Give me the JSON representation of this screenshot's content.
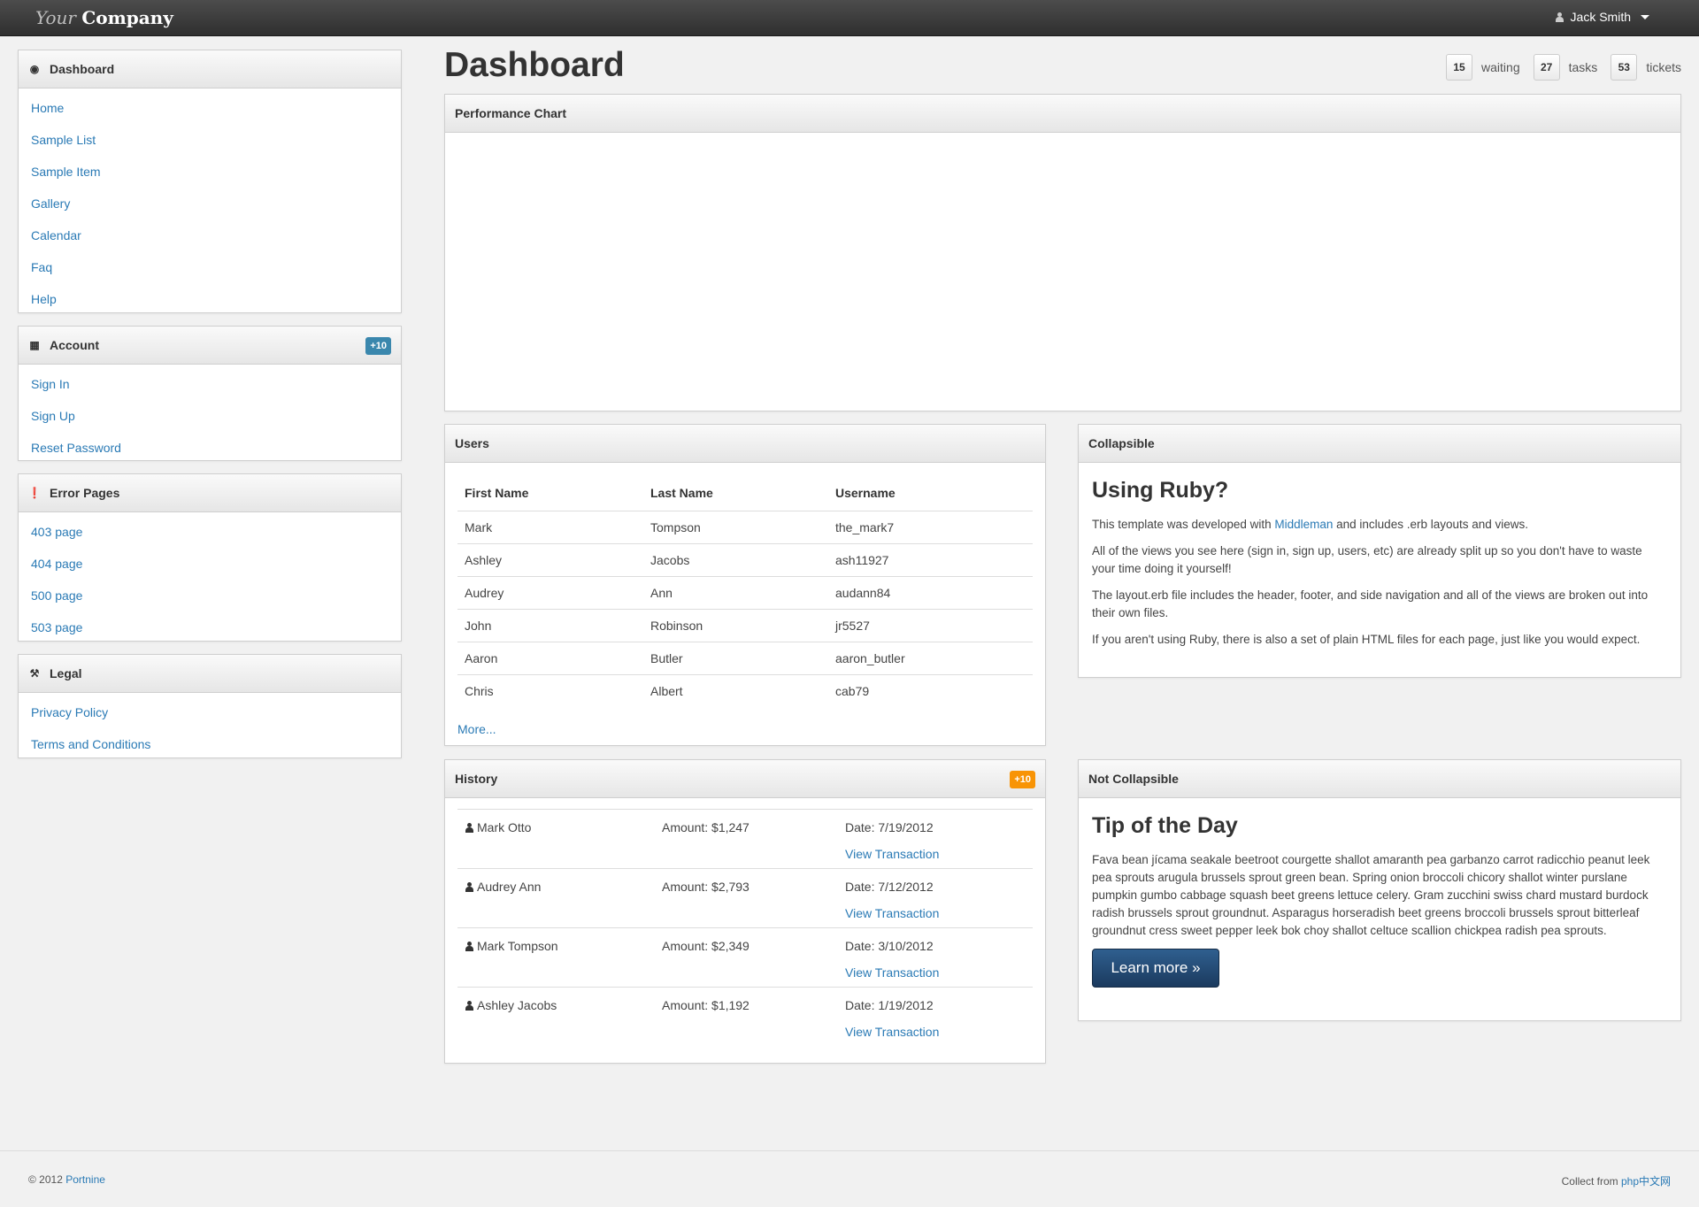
{
  "brand": {
    "part1": "Your",
    "part2": "Company"
  },
  "user": {
    "name": "Jack Smith"
  },
  "page": {
    "title": "Dashboard"
  },
  "stats": [
    {
      "value": "15",
      "label": "waiting"
    },
    {
      "value": "27",
      "label": "tasks"
    },
    {
      "value": "53",
      "label": "tickets"
    }
  ],
  "sidebar": {
    "dashboard": {
      "title": "Dashboard",
      "icon": "dashboard-icon",
      "items": [
        "Home",
        "Sample List",
        "Sample Item",
        "Gallery",
        "Calendar",
        "Faq",
        "Help"
      ]
    },
    "account": {
      "title": "Account",
      "icon": "briefcase-icon",
      "badge": "+10",
      "items": [
        "Sign In",
        "Sign Up",
        "Reset Password"
      ]
    },
    "errors": {
      "title": "Error Pages",
      "icon": "exclamation-icon",
      "items": [
        "403 page",
        "404 page",
        "500 page",
        "503 page"
      ]
    },
    "legal": {
      "title": "Legal",
      "icon": "gavel-icon",
      "items": [
        "Privacy Policy",
        "Terms and Conditions"
      ]
    }
  },
  "performance": {
    "title": "Performance Chart"
  },
  "users": {
    "title": "Users",
    "columns": [
      "First Name",
      "Last Name",
      "Username"
    ],
    "rows": [
      [
        "Mark",
        "Tompson",
        "the_mark7"
      ],
      [
        "Ashley",
        "Jacobs",
        "ash11927"
      ],
      [
        "Audrey",
        "Ann",
        "audann84"
      ],
      [
        "John",
        "Robinson",
        "jr5527"
      ],
      [
        "Aaron",
        "Butler",
        "aaron_butler"
      ],
      [
        "Chris",
        "Albert",
        "cab79"
      ]
    ],
    "more": "More..."
  },
  "history": {
    "title": "History",
    "badge": "+10",
    "rows": [
      {
        "name": "Mark Otto",
        "amount": "Amount: $1,247",
        "date": "Date: 7/19/2012",
        "link": "View Transaction"
      },
      {
        "name": "Audrey Ann",
        "amount": "Amount: $2,793",
        "date": "Date: 7/12/2012",
        "link": "View Transaction"
      },
      {
        "name": "Mark Tompson",
        "amount": "Amount: $2,349",
        "date": "Date: 3/10/2012",
        "link": "View Transaction"
      },
      {
        "name": "Ashley Jacobs",
        "amount": "Amount: $1,192",
        "date": "Date: 1/19/2012",
        "link": "View Transaction"
      }
    ]
  },
  "collapsible": {
    "title": "Collapsible",
    "heading": "Using Ruby?",
    "p1_before": "This template was developed with ",
    "p1_link": "Middleman",
    "p1_after": " and includes .erb layouts and views.",
    "p2": "All of the views you see here (sign in, sign up, users, etc) are already split up so you don't have to waste your time doing it yourself!",
    "p3": "The layout.erb file includes the header, footer, and side navigation and all of the views are broken out into their own files.",
    "p4": "If you aren't using Ruby, there is also a set of plain HTML files for each page, just like you would expect."
  },
  "tip": {
    "title": "Not Collapsible",
    "heading": "Tip of the Day",
    "text": "Fava bean jícama seakale beetroot courgette shallot amaranth pea garbanzo carrot radicchio peanut leek pea sprouts arugula brussels sprout green bean. Spring onion broccoli chicory shallot winter purslane pumpkin gumbo cabbage squash beet greens lettuce celery. Gram zucchini swiss chard mustard burdock radish brussels sprout groundnut. Asparagus horseradish beet greens broccoli brussels sprout bitterleaf groundnut cress sweet pepper leek bok choy shallot celtuce scallion chickpea radish pea sprouts.",
    "button": "Learn more »"
  },
  "footer": {
    "copyright": "© 2012 ",
    "link": "Portnine",
    "right_prefix": "Collect from ",
    "right_link": "php中文网"
  }
}
